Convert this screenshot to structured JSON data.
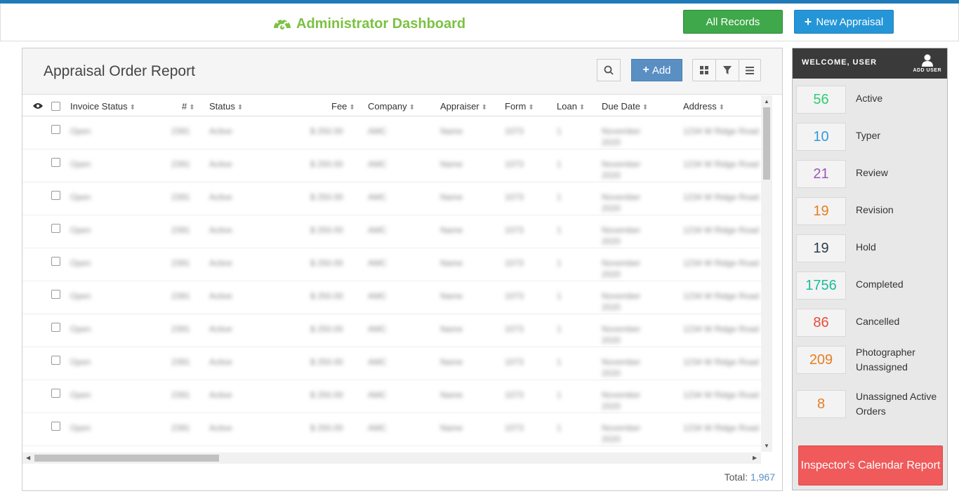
{
  "header": {
    "title": "Administrator Dashboard",
    "all_records": "All Records",
    "new_appraisal": "New Appraisal"
  },
  "report": {
    "title": "Appraisal Order Report",
    "add_label": "Add",
    "columns": [
      "Invoice Status",
      "#",
      "Status",
      "Fee",
      "Company",
      "Appraiser",
      "Form",
      "Loan",
      "Due Date",
      "Address"
    ],
    "rows_note": "blurred",
    "total_label": "Total:",
    "total_value": "1,967"
  },
  "panel": {
    "welcome": "WELCOME, USER",
    "add_user": "ADD USER",
    "stats": [
      {
        "value": "56",
        "label": "Active",
        "color": "#2ecc71"
      },
      {
        "value": "10",
        "label": "Typer",
        "color": "#3498db"
      },
      {
        "value": "21",
        "label": "Review",
        "color": "#9b59b6"
      },
      {
        "value": "19",
        "label": "Revision",
        "color": "#e67e22"
      },
      {
        "value": "19",
        "label": "Hold",
        "color": "#2c3e50"
      },
      {
        "value": "1756",
        "label": "Completed",
        "color": "#1abc9c"
      },
      {
        "value": "86",
        "label": "Cancelled",
        "color": "#e74c3c"
      },
      {
        "value": "209",
        "label": "Photographer Unassigned",
        "color": "#e67e22"
      },
      {
        "value": "8",
        "label": "Unassigned Active Orders",
        "color": "#e67e22"
      }
    ],
    "calendar_button": "Inspector's Calendar Report"
  }
}
